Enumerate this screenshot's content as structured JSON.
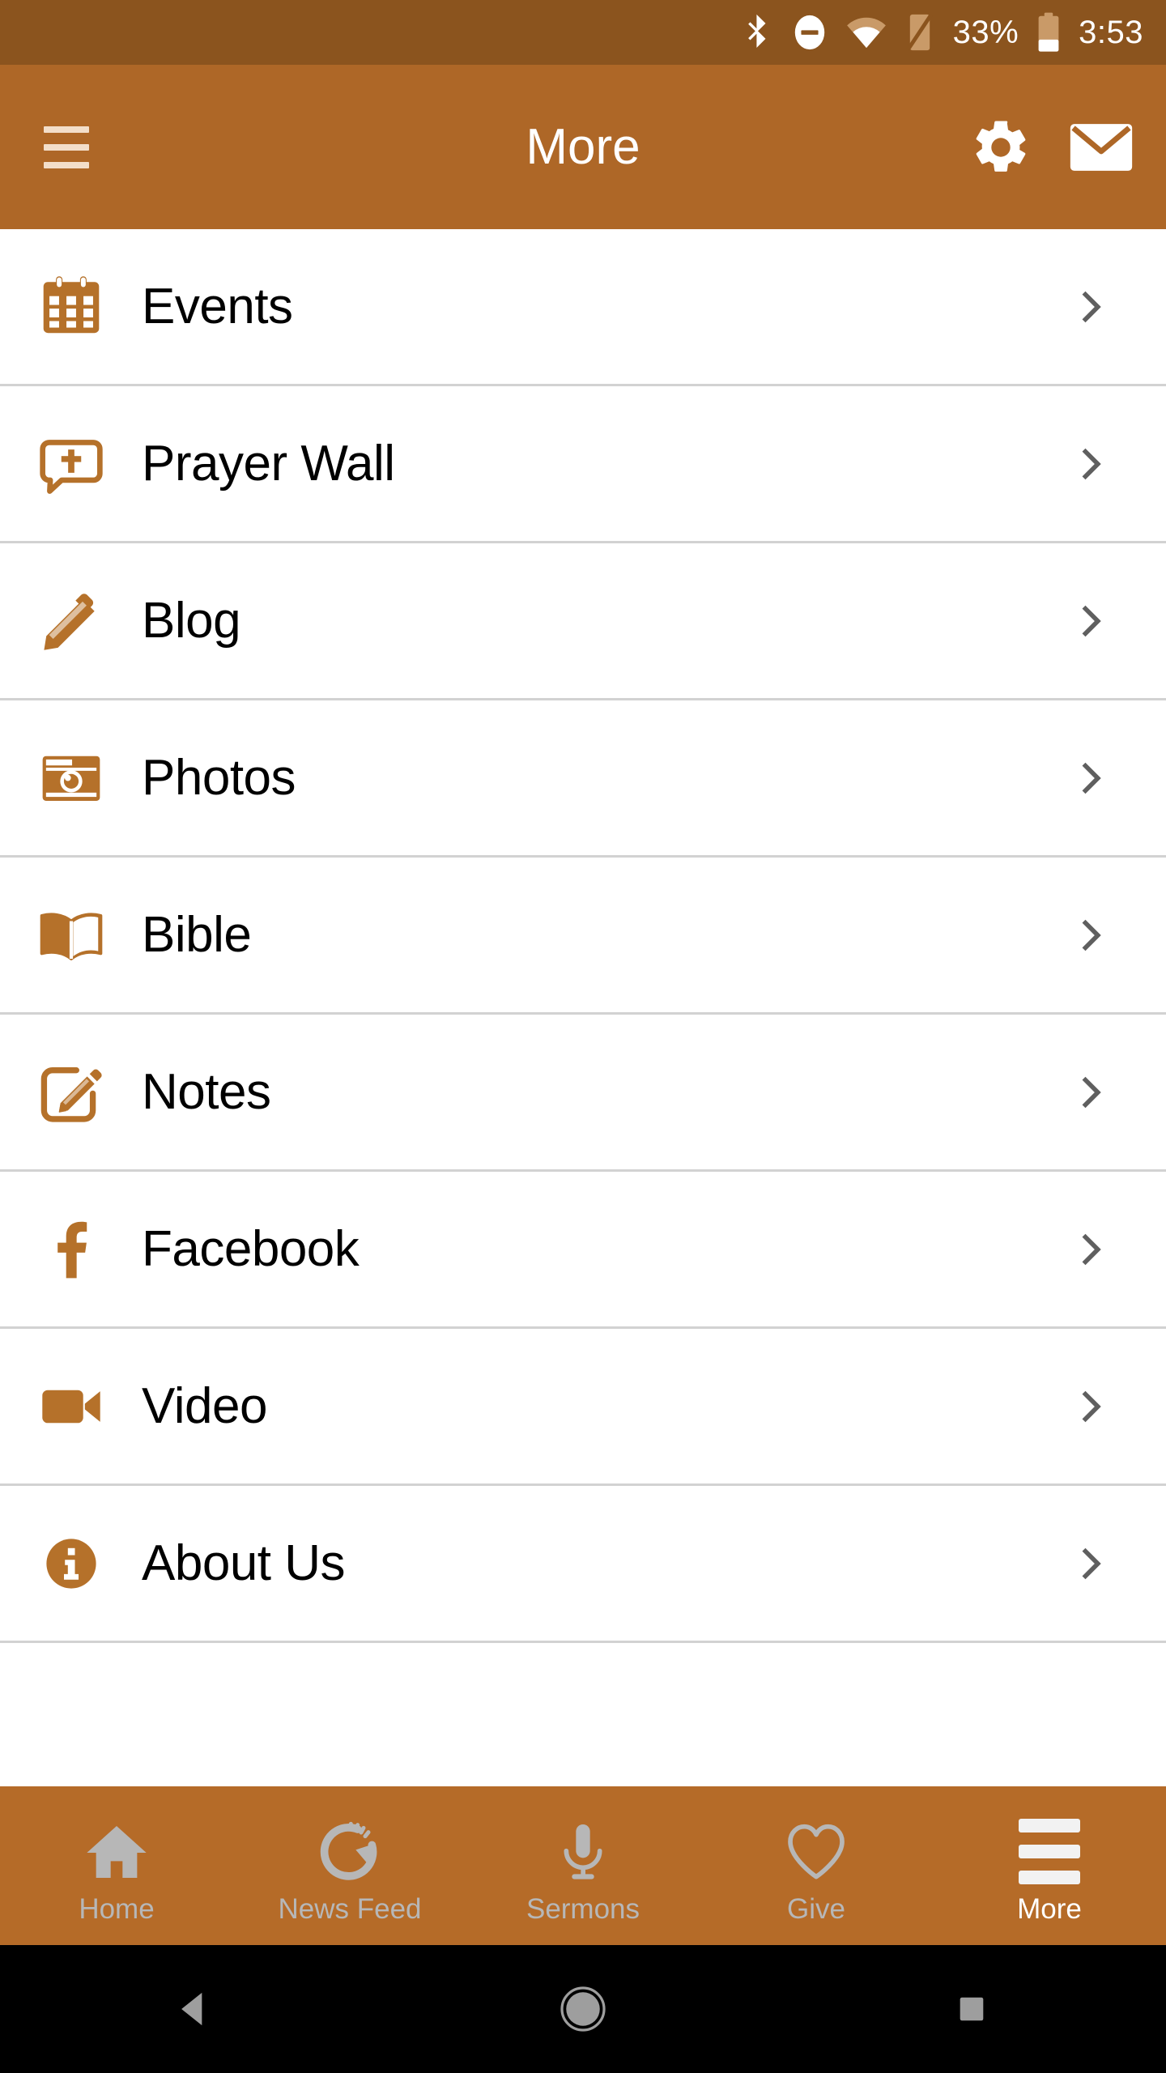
{
  "colors": {
    "status_bar_bg": "#8B541E",
    "app_bar_bg": "#AE6727",
    "tab_bar_bg": "#B56B28",
    "accent": "#B5712A",
    "icon_brown": "#B5712A",
    "divider": "#D2D2D2",
    "chevron": "#5F5F5F",
    "tab_inactive": "#B7B7B7",
    "tab_active": "#FFFFFF",
    "nav_bar_bg": "#000000"
  },
  "status_bar": {
    "icons": [
      "bluetooth-icon",
      "do-not-disturb-icon",
      "wifi-icon",
      "no-sim-icon",
      "battery-icon"
    ],
    "battery_percent": "33%",
    "clock": "3:53"
  },
  "app_bar": {
    "menu_icon": "hamburger-menu-icon",
    "title": "More",
    "actions": [
      {
        "name": "settings-button",
        "icon": "gear-icon"
      },
      {
        "name": "mail-button",
        "icon": "envelope-icon"
      }
    ]
  },
  "list": {
    "items": [
      {
        "label": "Events",
        "icon": "calendar-icon",
        "chevron": "chevron-right-icon"
      },
      {
        "label": "Prayer Wall",
        "icon": "prayer-bubble-icon",
        "chevron": "chevron-right-icon"
      },
      {
        "label": "Blog",
        "icon": "pencil-icon",
        "chevron": "chevron-right-icon"
      },
      {
        "label": "Photos",
        "icon": "camera-icon",
        "chevron": "chevron-right-icon"
      },
      {
        "label": "Bible",
        "icon": "open-book-icon",
        "chevron": "chevron-right-icon"
      },
      {
        "label": "Notes",
        "icon": "note-edit-icon",
        "chevron": "chevron-right-icon"
      },
      {
        "label": "Facebook",
        "icon": "facebook-icon",
        "chevron": "chevron-right-icon"
      },
      {
        "label": "Video",
        "icon": "video-camera-icon",
        "chevron": "chevron-right-icon"
      },
      {
        "label": "About Us",
        "icon": "info-circle-icon",
        "chevron": "chevron-right-icon"
      }
    ]
  },
  "tab_bar": {
    "tabs": [
      {
        "label": "Home",
        "icon": "house-icon",
        "active": false
      },
      {
        "label": "News Feed",
        "icon": "refresh-icon",
        "active": false
      },
      {
        "label": "Sermons",
        "icon": "microphone-icon",
        "active": false
      },
      {
        "label": "Give",
        "icon": "heart-icon",
        "active": false
      },
      {
        "label": "More",
        "icon": "hamburger-icon",
        "active": true
      }
    ]
  },
  "nav_bar": {
    "buttons": [
      {
        "name": "android-back-button",
        "icon": "back-triangle-icon"
      },
      {
        "name": "android-home-button",
        "icon": "home-circle-icon"
      },
      {
        "name": "android-recents-button",
        "icon": "recents-square-icon"
      }
    ]
  }
}
